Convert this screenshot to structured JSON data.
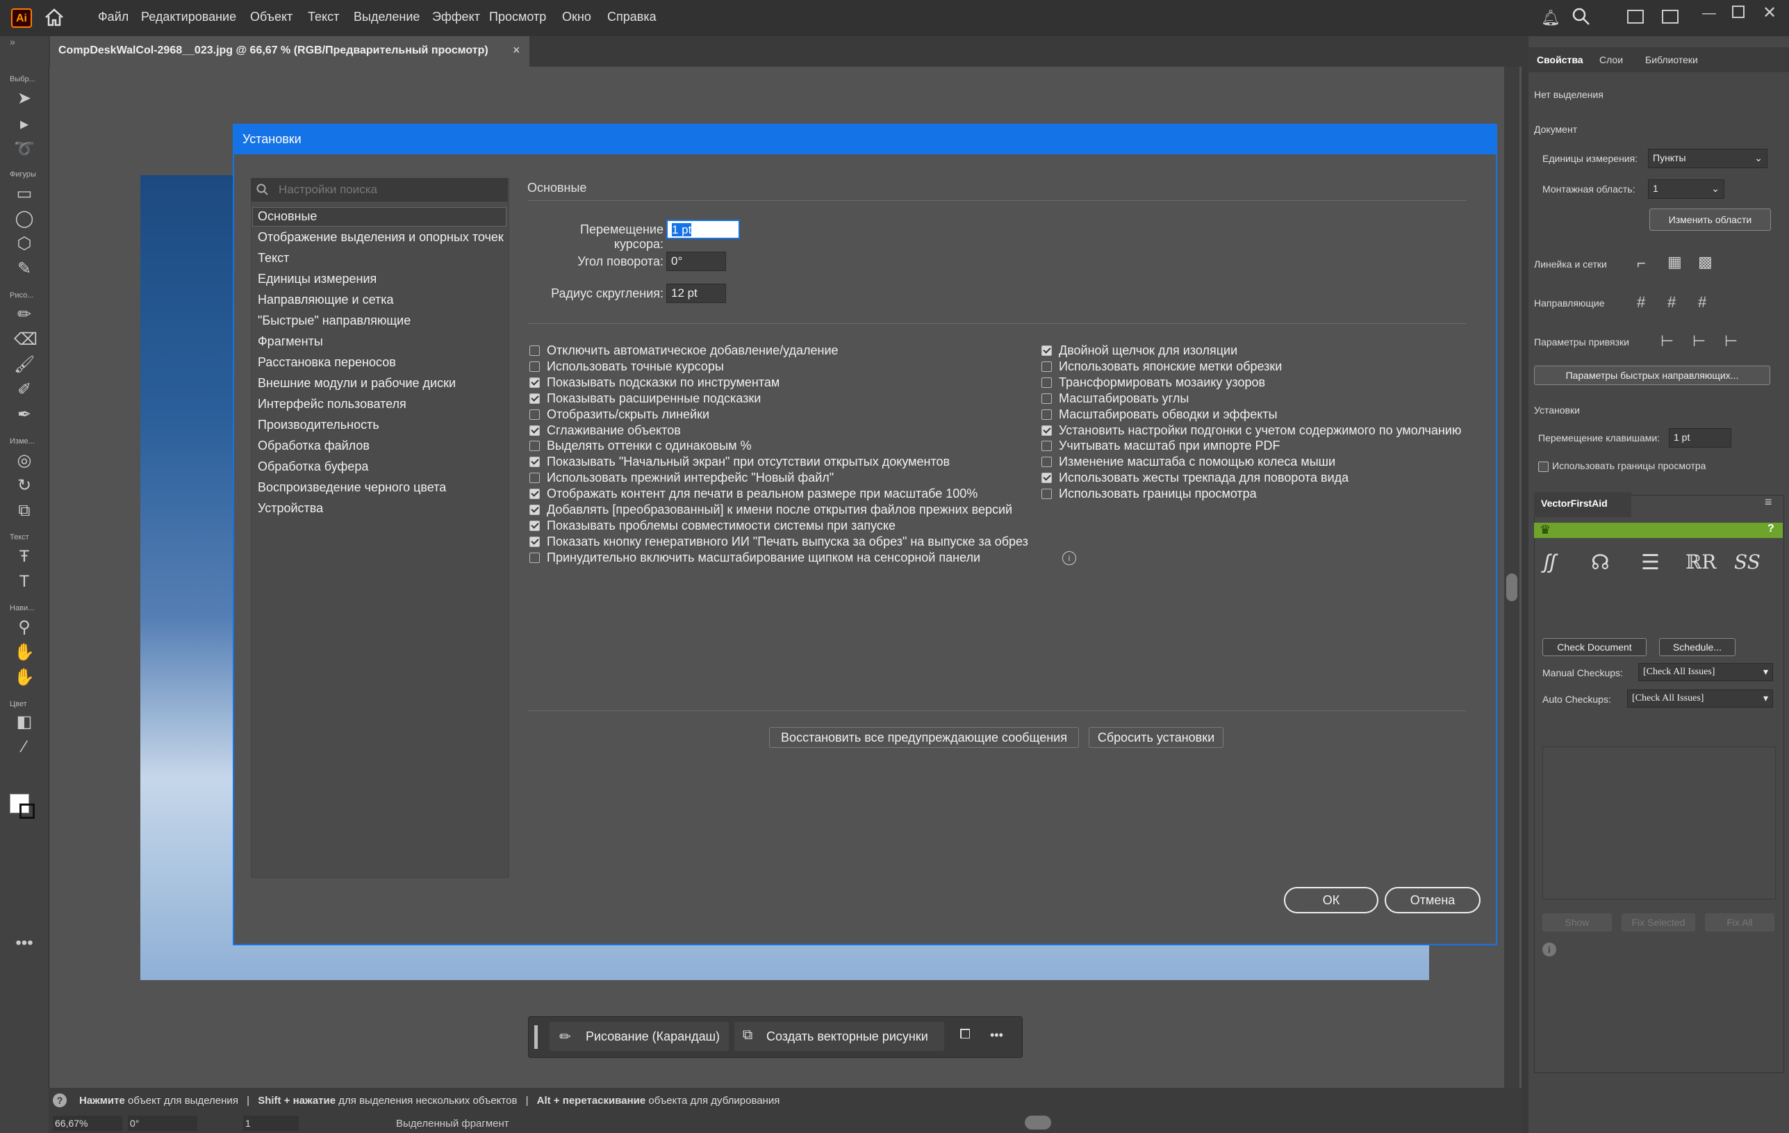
{
  "app": {
    "logo": "Ai"
  },
  "menu": [
    "Файл",
    "Редактирование",
    "Объект",
    "Текст",
    "Выделение",
    "Эффект",
    "Просмотр",
    "Окно",
    "Справка"
  ],
  "document": {
    "tab_title": "CompDeskWalCol-2968__023.jpg @ 66,67 % (RGB/Предварительный просмотр)",
    "close": "×"
  },
  "toolbar": {
    "labels": [
      "Выбр...",
      "Фигуры",
      "Рисо...",
      "Изме...",
      "Текст",
      "Нави...",
      "Цвет"
    ]
  },
  "dialog": {
    "title": "Установки",
    "search_placeholder": "Настройки поиска",
    "section": "Основные",
    "nav": [
      "Основные",
      "Отображение выделения и опорных точек",
      "Текст",
      "Единицы измерения",
      "Направляющие и сетка",
      "\"Быстрые\" направляющие",
      "Фрагменты",
      "Расстановка переносов",
      "Внешние модули и рабочие диски",
      "Интерфейс пользователя",
      "Производительность",
      "Обработка файлов",
      "Обработка буфера",
      "Воспроизведение черного цвета",
      "Устройства"
    ],
    "fields": {
      "cursor_label": "Перемещение курсора:",
      "cursor_value": "1 pt",
      "angle_label": "Угол поворота:",
      "angle_value": "0°",
      "radius_label": "Радиус скругления:",
      "radius_value": "12 pt"
    },
    "left_options": [
      {
        "label": "Отключить автоматическое добавление/удаление",
        "checked": false
      },
      {
        "label": "Использовать точные курсоры",
        "checked": false
      },
      {
        "label": "Показывать подсказки по инструментам",
        "checked": true
      },
      {
        "label": "Показывать расширенные подсказки",
        "checked": true
      },
      {
        "label": "Отобразить/скрыть линейки",
        "checked": false
      },
      {
        "label": "Сглаживание объектов",
        "checked": true
      },
      {
        "label": "Выделять оттенки с одинаковым %",
        "checked": false
      },
      {
        "label": "Показывать \"Начальный экран\" при отсутствии открытых документов",
        "checked": true
      },
      {
        "label": "Использовать прежний интерфейс \"Новый файл\"",
        "checked": false
      },
      {
        "label": "Отображать контент для печати в реальном размере при масштабе 100%",
        "checked": true
      },
      {
        "label": "Добавлять [преобразованный] к имени после открытия файлов прежних версий",
        "checked": true
      },
      {
        "label": "Показывать проблемы совместимости системы при запуске",
        "checked": true
      },
      {
        "label": "Показать кнопку генеративного ИИ \"Печать выпуска за обрез\" на выпуске за обрез",
        "checked": true
      },
      {
        "label": "Принудительно включить масштабирование щипком на сенсорной панели",
        "checked": false
      }
    ],
    "right_options": [
      {
        "label": "Двойной щелчок для изоляции",
        "checked": true
      },
      {
        "label": "Использовать японские метки обрезки",
        "checked": false
      },
      {
        "label": "Трансформировать мозаику узоров",
        "checked": false
      },
      {
        "label": "Масштабировать углы",
        "checked": false
      },
      {
        "label": "Масштабировать обводки и эффекты",
        "checked": false
      },
      {
        "label": "Установить настройки подгонки с учетом содержимого по умолчанию",
        "checked": true
      },
      {
        "label": "Учитывать масштаб при импорте PDF",
        "checked": false
      },
      {
        "label": "Изменение масштаба с помощью колеса мыши",
        "checked": false
      },
      {
        "label": "Использовать жесты трекпада для поворота вида",
        "checked": true
      },
      {
        "label": "Использовать границы просмотра",
        "checked": false
      }
    ],
    "restore_button": "Восстановить все предупреждающие сообщения",
    "reset_button": "Сбросить установки",
    "ok": "ОК",
    "cancel": "Отмена"
  },
  "context_bar": {
    "draw": "Рисование (Карандаш)",
    "vector": "Создать векторные рисунки",
    "more": "•••"
  },
  "status": {
    "hint_click": "Нажмите",
    "hint_click_rest": " объект для выделения",
    "hint_shift": "Shift + нажатие",
    "hint_shift_rest": " для выделения нескольких объектов",
    "hint_alt": "Alt + перетаскивание",
    "hint_alt_rest": " объекта для дублирования",
    "sep": "|",
    "zoom": "66,67%",
    "rotation": "0°",
    "artboard": "1",
    "selection": "Выделенный фрагмент"
  },
  "right_panel": {
    "tabs": [
      "Свойства",
      "Слои",
      "Библиотеки"
    ],
    "no_selection": "Нет выделения",
    "document": "Документ",
    "units_label": "Единицы измерения:",
    "units_value": "Пункты",
    "artboard_label": "Монтажная область:",
    "artboard_value": "1",
    "edit_artboards": "Изменить области",
    "rulers": "Линейка и сетки",
    "guides": "Направляющие",
    "snap": "Параметры привязки",
    "smart_guides_btn": "Параметры быстрых направляющих...",
    "prefs": "Установки",
    "keyboard_label": "Перемещение клавишами:",
    "keyboard_value": "1 pt",
    "preview_bounds": "Использовать границы просмотра",
    "plugin_title": "VectorFirstAid",
    "check_doc": "Check Document",
    "schedule": "Schedule...",
    "manual_label": "Manual Checkups:",
    "manual_value": "[Check All Issues]",
    "auto_label": "Auto Checkups:",
    "auto_value": "[Check All Issues]",
    "show": "Show",
    "fix_selected": "Fix Selected",
    "fix_all": "Fix All"
  },
  "colors": {
    "accent": "#1473e6",
    "panel": "#474747",
    "dialog": "#535353",
    "plugin_green": "#6fa42c"
  }
}
